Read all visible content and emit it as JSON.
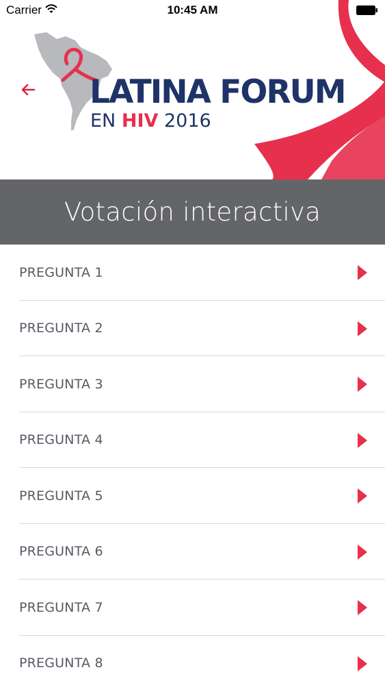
{
  "status_bar": {
    "carrier": "Carrier",
    "time": "10:45 AM"
  },
  "header": {
    "logo_title": "LATINA FORUM",
    "logo_sub_prefix": "EN ",
    "logo_sub_highlight": "HIV",
    "logo_sub_suffix": " 2016",
    "back_icon": "arrow-left-icon",
    "accent_color": "#e6304e",
    "brand_color": "#1e3368"
  },
  "section": {
    "title": "Votación interactiva",
    "background": "#646568"
  },
  "questions": [
    {
      "label": "PREGUNTA 1"
    },
    {
      "label": "PREGUNTA 2"
    },
    {
      "label": "PREGUNTA 3"
    },
    {
      "label": "PREGUNTA 4"
    },
    {
      "label": "PREGUNTA 5"
    },
    {
      "label": "PREGUNTA 6"
    },
    {
      "label": "PREGUNTA 7"
    },
    {
      "label": "PREGUNTA 8"
    }
  ]
}
